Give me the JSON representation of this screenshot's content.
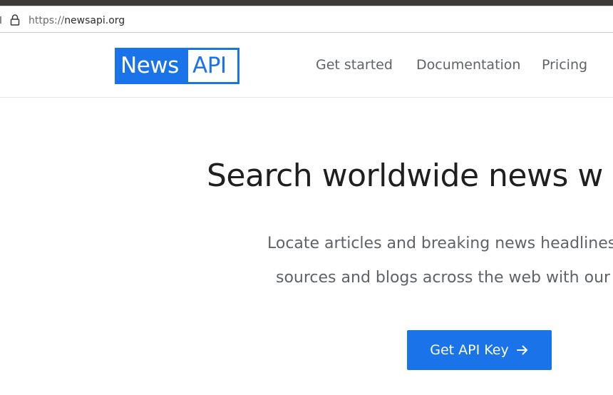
{
  "browser": {
    "url_scheme": "https://",
    "url_host": "newsapi.org"
  },
  "header": {
    "logo_news": "News",
    "logo_api": "API",
    "nav": {
      "get_started": "Get started",
      "documentation": "Documentation",
      "pricing": "Pricing"
    }
  },
  "hero": {
    "title": "Search worldwide news w",
    "line1": "Locate articles and breaking news headlines f",
    "line2": "sources and blogs across the web with our J"
  },
  "cta": {
    "label": "Get API Key",
    "arrow_icon": "arrow-right-icon"
  },
  "colors": {
    "brand_blue": "#1a73e8",
    "nav_gray": "#5f6368",
    "title_dark": "#1f1f1f"
  }
}
